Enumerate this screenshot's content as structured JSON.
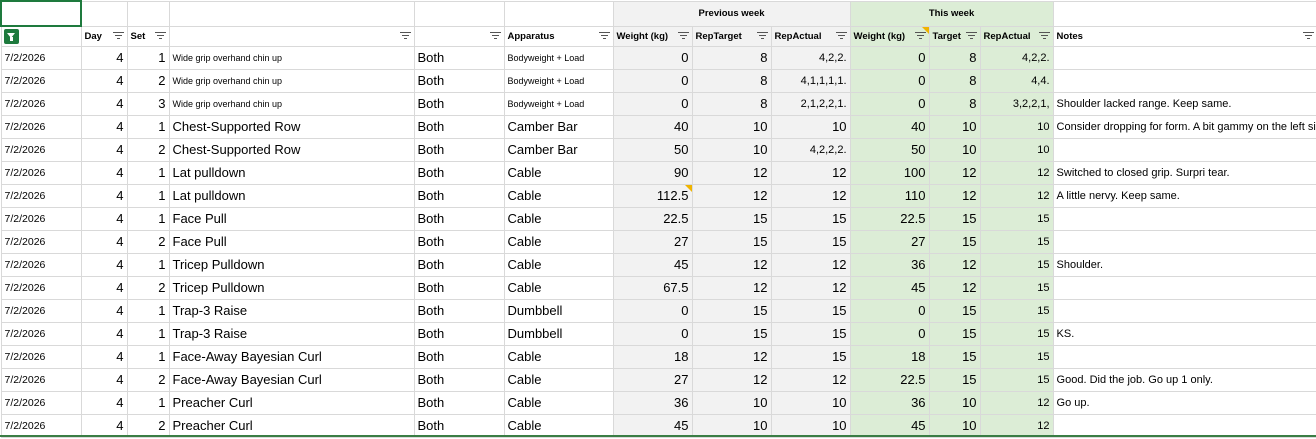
{
  "groups": {
    "previous_week": "Previous week",
    "this_week": "This week"
  },
  "headers": {
    "day": "Day",
    "set": "Set",
    "apparatus": "Apparatus",
    "prev_weight": "Weight (kg)",
    "prev_reptarget": "RepTarget",
    "prev_repactual": "RepActual",
    "this_weight": "Weight (kg)",
    "this_target": "Target",
    "this_repactual": "RepActual",
    "notes": "Notes"
  },
  "colors": {
    "header_filter_active": "#1e7a3d",
    "this_week_fill": "#dcedd6",
    "prev_week_fill": "#f2f2f2",
    "comment_marker": "#f0b400"
  },
  "rows": [
    {
      "date": "7/2/2026",
      "day": "4",
      "set": "1",
      "exercise": "Wide grip overhand chin up",
      "side": "Both",
      "apparatus": "Bodyweight + Load",
      "pw": "0",
      "prt": "8",
      "pra": "4,2,2.",
      "tw": "0",
      "tt": "8",
      "tra": "4,2,2.",
      "notes": ""
    },
    {
      "date": "7/2/2026",
      "day": "4",
      "set": "2",
      "exercise": "Wide grip overhand chin up",
      "side": "Both",
      "apparatus": "Bodyweight + Load",
      "pw": "0",
      "prt": "8",
      "pra": "4,1,1,1,1.",
      "tw": "0",
      "tt": "8",
      "tra": "4,4.",
      "notes": ""
    },
    {
      "date": "7/2/2026",
      "day": "4",
      "set": "3",
      "exercise": "Wide grip overhand chin up",
      "side": "Both",
      "apparatus": "Bodyweight + Load",
      "pw": "0",
      "prt": "8",
      "pra": "2,1,2,2,1.",
      "tw": "0",
      "tt": "8",
      "tra": "3,2,2,1,",
      "notes": "Shoulder lacked range. Keep same."
    },
    {
      "date": "7/2/2026",
      "day": "4",
      "set": "1",
      "exercise": "Chest-Supported Row",
      "side": "Both",
      "apparatus": "Camber Bar",
      "pw": "40",
      "prt": "10",
      "pra": "10",
      "tw": "40",
      "tt": "10",
      "tra": "10",
      "notes": "Consider dropping for form. A bit gammy on the left side"
    },
    {
      "date": "7/2/2026",
      "day": "4",
      "set": "2",
      "exercise": "Chest-Supported Row",
      "side": "Both",
      "apparatus": "Camber Bar",
      "pw": "50",
      "prt": "10",
      "pra": "4,2,2,2.",
      "tw": "50",
      "tt": "10",
      "tra": "10",
      "notes": ""
    },
    {
      "date": "7/2/2026",
      "day": "4",
      "set": "1",
      "exercise": "Lat pulldown",
      "side": "Both",
      "apparatus": "Cable",
      "pw": "90",
      "prt": "12",
      "pra": "12",
      "tw": "100",
      "tt": "12",
      "tra": "12",
      "notes": "Switched to closed grip. Surpri tear."
    },
    {
      "date": "7/2/2026",
      "day": "4",
      "set": "1",
      "exercise": "Lat pulldown",
      "side": "Both",
      "apparatus": "Cable",
      "pw": "112.5",
      "prt": "12",
      "pra": "12",
      "tw": "110",
      "tt": "12",
      "tra": "12",
      "notes": "A little nervy. Keep same."
    },
    {
      "date": "7/2/2026",
      "day": "4",
      "set": "1",
      "exercise": "Face Pull",
      "side": "Both",
      "apparatus": "Cable",
      "pw": "22.5",
      "prt": "15",
      "pra": "15",
      "tw": "22.5",
      "tt": "15",
      "tra": "15",
      "notes": ""
    },
    {
      "date": "7/2/2026",
      "day": "4",
      "set": "2",
      "exercise": "Face Pull",
      "side": "Both",
      "apparatus": "Cable",
      "pw": "27",
      "prt": "15",
      "pra": "15",
      "tw": "27",
      "tt": "15",
      "tra": "15",
      "notes": ""
    },
    {
      "date": "7/2/2026",
      "day": "4",
      "set": "1",
      "exercise": "Tricep Pulldown",
      "side": "Both",
      "apparatus": "Cable",
      "pw": "45",
      "prt": "12",
      "pra": "12",
      "tw": "36",
      "tt": "12",
      "tra": "15",
      "notes": "Shoulder."
    },
    {
      "date": "7/2/2026",
      "day": "4",
      "set": "2",
      "exercise": "Tricep Pulldown",
      "side": "Both",
      "apparatus": "Cable",
      "pw": "67.5",
      "prt": "12",
      "pra": "12",
      "tw": "45",
      "tt": "12",
      "tra": "15",
      "notes": ""
    },
    {
      "date": "7/2/2026",
      "day": "4",
      "set": "1",
      "exercise": "Trap-3 Raise",
      "side": "Both",
      "apparatus": "Dumbbell",
      "pw": "0",
      "prt": "15",
      "pra": "15",
      "tw": "0",
      "tt": "15",
      "tra": "15",
      "notes": ""
    },
    {
      "date": "7/2/2026",
      "day": "4",
      "set": "1",
      "exercise": "Trap-3 Raise",
      "side": "Both",
      "apparatus": "Dumbbell",
      "pw": "0",
      "prt": "15",
      "pra": "15",
      "tw": "0",
      "tt": "15",
      "tra": "15",
      "notes": "KS."
    },
    {
      "date": "7/2/2026",
      "day": "4",
      "set": "1",
      "exercise": "Face-Away Bayesian Curl",
      "side": "Both",
      "apparatus": "Cable",
      "pw": "18",
      "prt": "12",
      "pra": "15",
      "tw": "18",
      "tt": "15",
      "tra": "15",
      "notes": ""
    },
    {
      "date": "7/2/2026",
      "day": "4",
      "set": "2",
      "exercise": "Face-Away Bayesian Curl",
      "side": "Both",
      "apparatus": "Cable",
      "pw": "27",
      "prt": "12",
      "pra": "12",
      "tw": "22.5",
      "tt": "15",
      "tra": "15",
      "notes": "Good. Did the job. Go up 1 only."
    },
    {
      "date": "7/2/2026",
      "day": "4",
      "set": "1",
      "exercise": "Preacher Curl",
      "side": "Both",
      "apparatus": "Cable",
      "pw": "36",
      "prt": "10",
      "pra": "10",
      "tw": "36",
      "tt": "10",
      "tra": "12",
      "notes": "Go up."
    },
    {
      "date": "7/2/2026",
      "day": "4",
      "set": "2",
      "exercise": "Preacher Curl",
      "side": "Both",
      "apparatus": "Cable",
      "pw": "45",
      "prt": "10",
      "pra": "10",
      "tw": "45",
      "tt": "10",
      "tra": "12",
      "notes": ""
    }
  ]
}
